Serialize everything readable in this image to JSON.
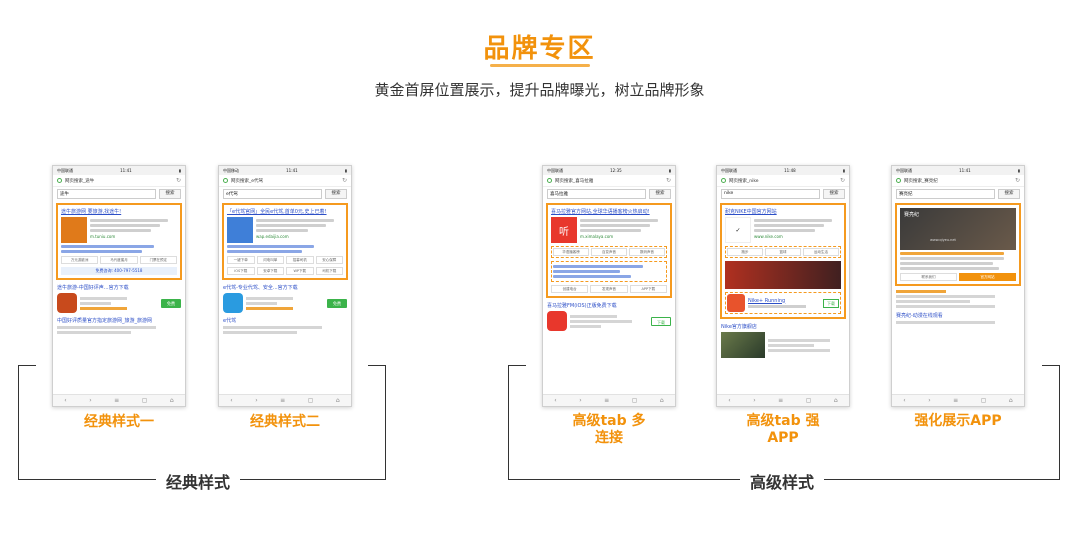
{
  "header": {
    "title": "品牌专区",
    "subtitle": "黄金首屏位置展示，提升品牌曝光，树立品牌形象"
  },
  "phones": [
    {
      "status_left": "中国联通",
      "status_time": "11:41",
      "url": "网页搜索_途牛",
      "query": "途牛",
      "search_btn": "搜索",
      "ad_title": "途牛旅游网 要旅游,找途牛!",
      "ad_url": "m.tuniu.com",
      "links": [
        "万元游欧洲",
        "马代度蜜月",
        "门票在预定"
      ],
      "tel": "免费咨询: 400-797-5518",
      "org_title": "途牛旅游-中国好评声...官方下载",
      "download": "免费",
      "org2_title": "中国好评质量官方指定旅游网_旅游_旅游网"
    },
    {
      "status_left": "中国移动",
      "status_time": "11:41",
      "url": "网页搜索_e代驾",
      "query": "e代驾",
      "search_btn": "搜索",
      "ad_title": "「e代驾官网」全民e代驾,首单0元,史上已着!",
      "ad_url": "wap.edaijia.com",
      "links": [
        "一键下单",
        "闪电叫单",
        "招募司机",
        "安心保障"
      ],
      "links2": [
        "iOS下载",
        "安卓下载",
        "WP下载",
        "司机下载"
      ],
      "org_title": "e代驾-专业代驾、安全...官方下载",
      "download": "免费",
      "org2_title": "e代驾"
    },
    {
      "status_left": "中国联通",
      "status_time": "12:35",
      "url": "网页搜索_喜马拉雅",
      "query": "喜马拉雅",
      "search_btn": "搜索",
      "ad_title": "喜马拉雅官方网站,全球华语播客榜火热启动!",
      "ad_url": "m.ximalaya.com",
      "links": [
        "华语播客榜",
        "百变声音",
        "数码声音"
      ],
      "tabs": [
        "创建电台",
        "发现声音",
        "APP下载"
      ],
      "org_title": "喜马拉雅FM(iOS)正版免费下载",
      "download": "下载",
      "org2_title": ""
    },
    {
      "status_left": "中国联通",
      "status_time": "11:48",
      "url": "网页搜索_nike",
      "query": "nike",
      "search_btn": "搜索",
      "ad_title": "耐克NIKE中国官方网站",
      "ad_url": "www.nike.com",
      "links": [
        "跑步",
        "篮球",
        "运动生活"
      ],
      "app_title": "Nike+ Running",
      "download": "下载",
      "org_title": "Nike官方旗舰店",
      "org2_title": ""
    },
    {
      "status_left": "中国联通",
      "status_time": "11:41",
      "url": "网页搜索_赛亮纪",
      "query": "赛亮纪",
      "search_btn": "搜索",
      "ad_title": "赛亮纪",
      "ad_url": "www.qiyeu.net",
      "links": [
        "联系我们",
        "官方网站"
      ],
      "org_title": "赛亮纪-动漫在线观看",
      "org2_title": ""
    }
  ],
  "captions": [
    "经典样式一",
    "经典样式二",
    "高级tab 多连接",
    "高级tab 强APP",
    "强化展示APP"
  ],
  "groups": [
    "经典样式",
    "高级样式"
  ],
  "colors": {
    "accent": "#f2920c",
    "ad_border": "#f59a1f",
    "link": "#2d4fc7",
    "download": "#3bb34a"
  }
}
